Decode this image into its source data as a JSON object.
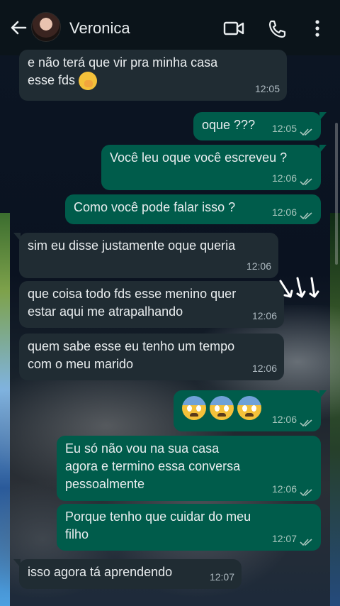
{
  "header": {
    "back_icon": "arrow-left-icon",
    "contact_name": "Veronica",
    "video_icon": "video-camera-icon",
    "call_icon": "phone-icon",
    "menu_icon": "more-vertical-icon"
  },
  "colors": {
    "header_bg": "#0b141a",
    "incoming_bubble": "#202c33",
    "outgoing_bubble": "#005c4b",
    "text": "#e9edef"
  },
  "messages": [
    {
      "direction": "in",
      "text": "e não terá que vir pra minha casa",
      "text2": "esse fds",
      "emoji": "shushing-face",
      "time": "12:05"
    },
    {
      "direction": "out",
      "text": "oque ???",
      "time": "12:05",
      "read": true
    },
    {
      "direction": "out",
      "text": "Você leu oque você escreveu ?",
      "time": "12:06",
      "read": true
    },
    {
      "direction": "out",
      "text": "Como você pode falar isso ?",
      "time": "12:06",
      "read": true
    },
    {
      "direction": "in",
      "text": "sim eu disse justamente oque queria",
      "time": "12:06"
    },
    {
      "direction": "in",
      "text": "que coisa todo fds esse menino quer",
      "text2": "estar aqui me atrapalhando",
      "time": "12:06"
    },
    {
      "direction": "in",
      "text": "quem sabe esse eu tenho um tempo",
      "text2": "com o meu marido",
      "time": "12:06"
    },
    {
      "direction": "out",
      "emoji": "fearful-face x3",
      "time": "12:06",
      "read": true
    },
    {
      "direction": "out",
      "text": "Eu só não vou na sua casa",
      "text2": "agora e termino essa conversa",
      "text3": "pessoalmente",
      "time": "12:06",
      "read": true
    },
    {
      "direction": "out",
      "text": "Porque tenho que cuidar do meu",
      "text2": "filho",
      "time": "12:07",
      "read": true
    },
    {
      "direction": "in",
      "text": "isso agora tá aprendendo",
      "time": "12:07"
    }
  ]
}
